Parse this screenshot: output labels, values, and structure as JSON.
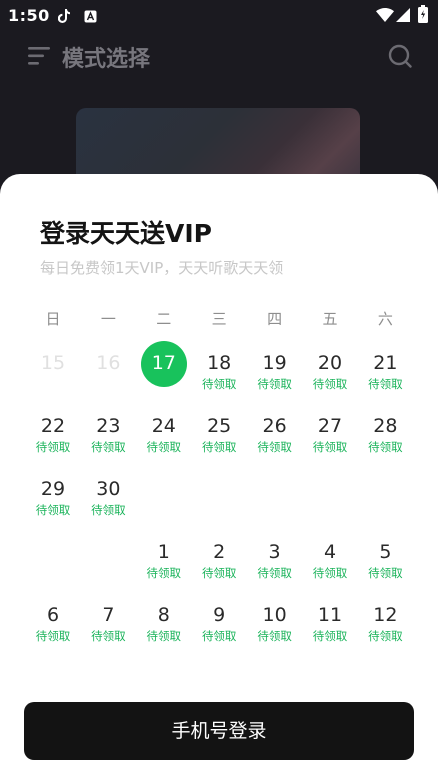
{
  "status": {
    "time": "1:50"
  },
  "header": {
    "title": "模式选择"
  },
  "sheet": {
    "title": "登录天天送VIP",
    "subtitle": "每日免费领1天VIP，天天听歌天天领"
  },
  "weekdays": [
    "日",
    "一",
    "二",
    "三",
    "四",
    "五",
    "六"
  ],
  "calendar": {
    "tag_label": "待领取",
    "rows": [
      [
        {
          "d": "15",
          "state": "past"
        },
        {
          "d": "16",
          "state": "past"
        },
        {
          "d": "17",
          "state": "today"
        },
        {
          "d": "18",
          "state": "pending"
        },
        {
          "d": "19",
          "state": "pending"
        },
        {
          "d": "20",
          "state": "pending"
        },
        {
          "d": "21",
          "state": "pending"
        }
      ],
      [
        {
          "d": "22",
          "state": "pending"
        },
        {
          "d": "23",
          "state": "pending"
        },
        {
          "d": "24",
          "state": "pending"
        },
        {
          "d": "25",
          "state": "pending"
        },
        {
          "d": "26",
          "state": "pending"
        },
        {
          "d": "27",
          "state": "pending"
        },
        {
          "d": "28",
          "state": "pending"
        }
      ],
      [
        {
          "d": "29",
          "state": "pending"
        },
        {
          "d": "30",
          "state": "pending"
        }
      ],
      [
        null,
        null,
        {
          "d": "1",
          "state": "pending"
        },
        {
          "d": "2",
          "state": "pending"
        },
        {
          "d": "3",
          "state": "pending"
        },
        {
          "d": "4",
          "state": "pending"
        },
        {
          "d": "5",
          "state": "pending"
        }
      ],
      [
        {
          "d": "6",
          "state": "pending"
        },
        {
          "d": "7",
          "state": "pending"
        },
        {
          "d": "8",
          "state": "pending"
        },
        {
          "d": "9",
          "state": "pending"
        },
        {
          "d": "10",
          "state": "pending"
        },
        {
          "d": "11",
          "state": "pending"
        },
        {
          "d": "12",
          "state": "pending"
        }
      ]
    ]
  },
  "login_button": {
    "label": "手机号登录"
  },
  "colors": {
    "accent": "#18c25c",
    "tag": "#1ab35a",
    "button_bg": "#131313"
  },
  "icons": [
    "menu-icon",
    "search-icon",
    "wifi-icon",
    "signal-icon",
    "battery-icon",
    "tiktok-icon",
    "a-icon"
  ]
}
